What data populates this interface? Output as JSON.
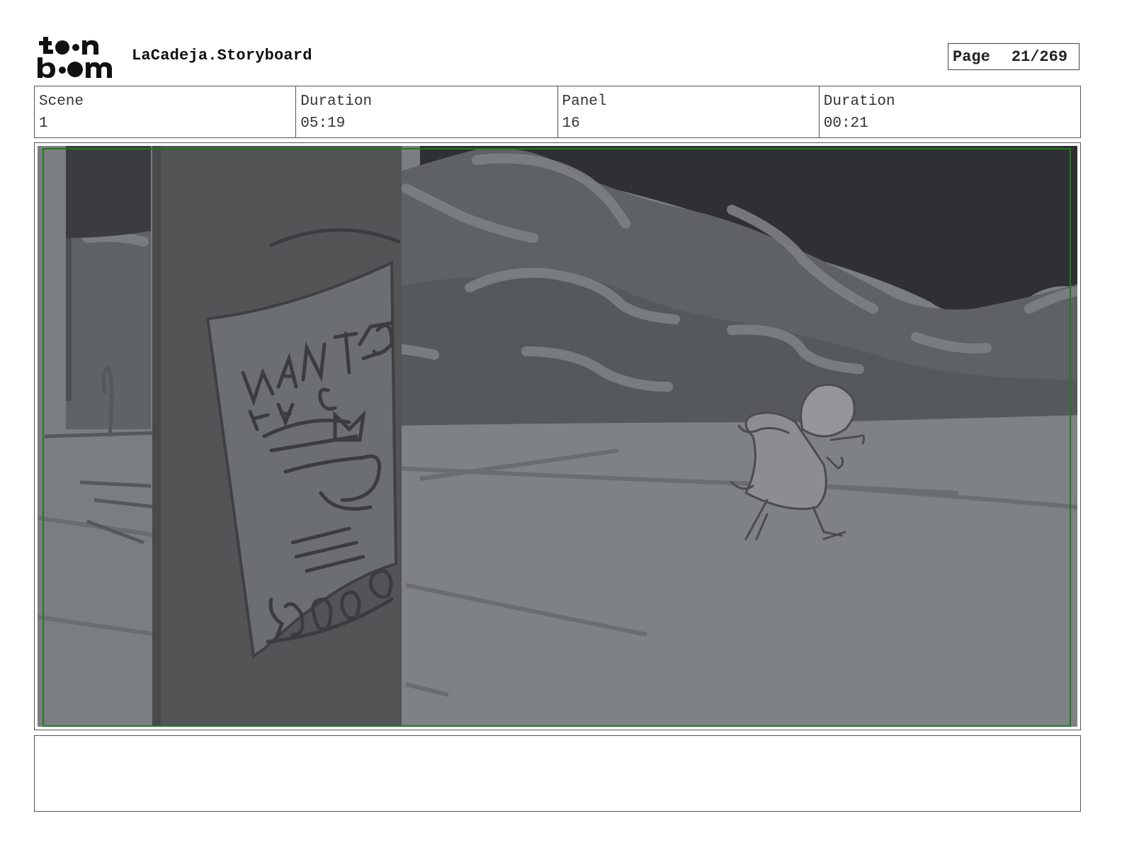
{
  "header": {
    "logo_text": "toon boom",
    "title": "LaCadeja.Storyboard",
    "page_label": "Page",
    "page_value": "21/269"
  },
  "info": {
    "scene_label": "Scene",
    "scene_value": "1",
    "scene_duration_label": "Duration",
    "scene_duration_value": "05:19",
    "panel_label": "Panel",
    "panel_value": "16",
    "panel_duration_label": "Duration",
    "panel_duration_value": "00:21"
  },
  "panel": {
    "poster_text": "WANTED LA CADEJA $5000",
    "safe_frame_color": "#1e7a1e"
  },
  "notes": {
    "text": ""
  }
}
